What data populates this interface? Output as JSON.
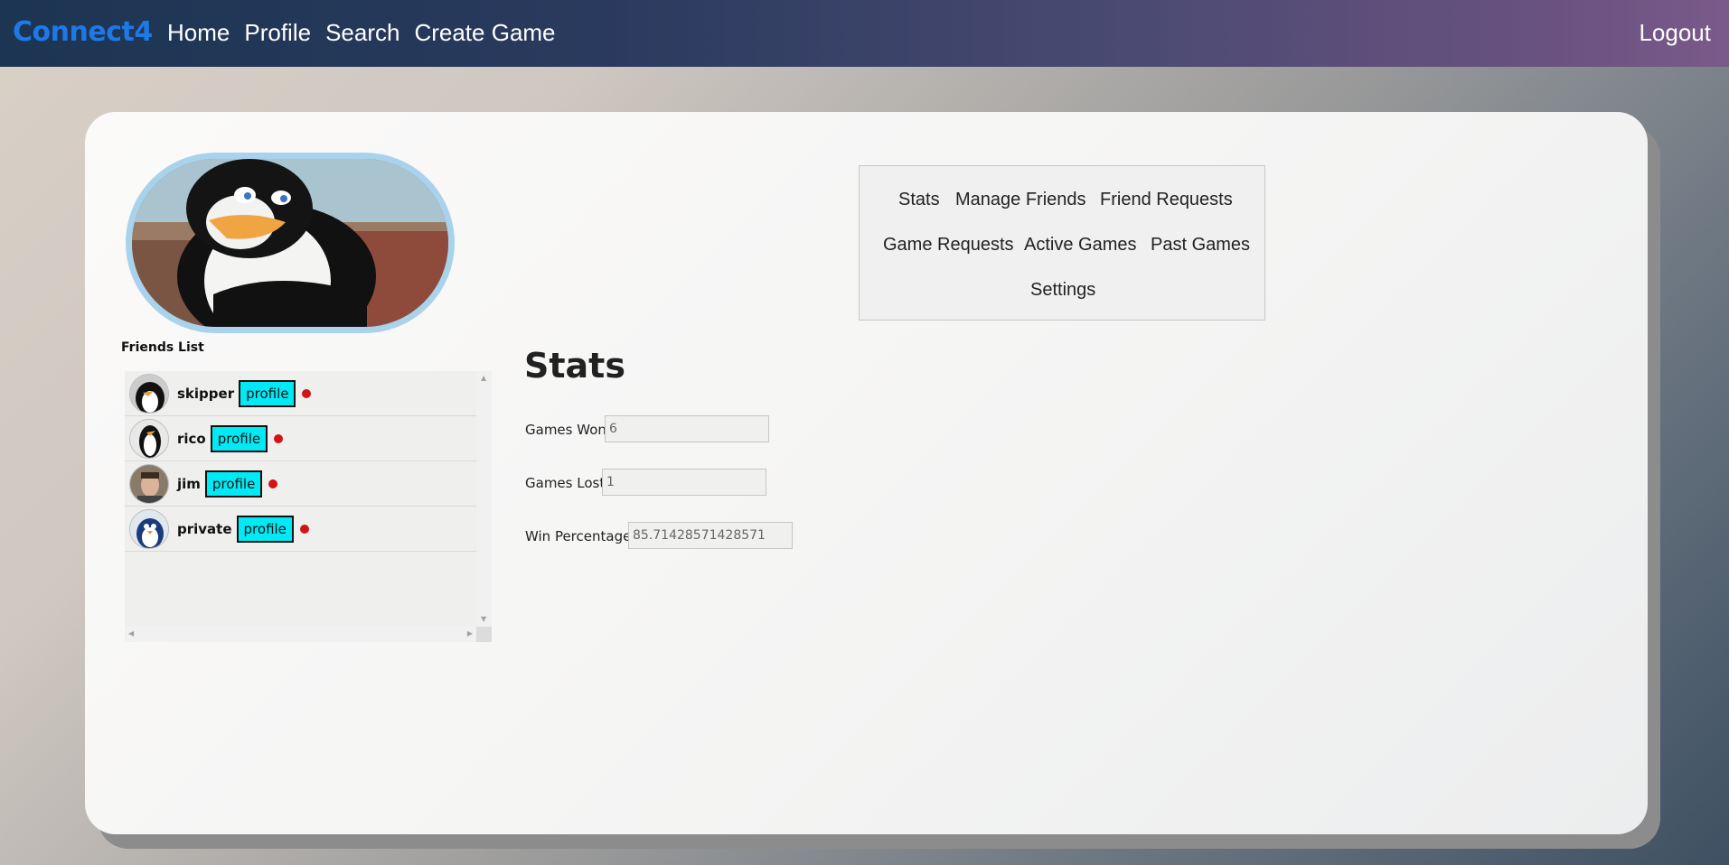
{
  "navbar": {
    "brand": "Connect4",
    "links": [
      "Home",
      "Profile",
      "Search",
      "Create Game"
    ],
    "logout": "Logout"
  },
  "friends": {
    "title": "Friends List",
    "button_label": "profile",
    "items": [
      {
        "name": "skipper",
        "status_color": "#d21414"
      },
      {
        "name": "rico",
        "status_color": "#d21414"
      },
      {
        "name": "jim",
        "status_color": "#d21414"
      },
      {
        "name": "private",
        "status_color": "#d21414"
      }
    ]
  },
  "tabs": [
    "Stats",
    "Manage Friends",
    "Friend Requests",
    "Game Requests",
    "Active Games",
    "Past Games",
    "Settings"
  ],
  "stats": {
    "title": "Stats",
    "games_won_label": "Games Won:",
    "games_won_value": "6",
    "games_lost_label": "Games Lost:",
    "games_lost_value": "1",
    "win_pct_label": "Win Percentage:",
    "win_pct_value": "85.71428571428571"
  },
  "colors": {
    "brand": "#1e78e6",
    "profile_button": "#00eaf5",
    "avatar_border": "#a9d2ec"
  }
}
